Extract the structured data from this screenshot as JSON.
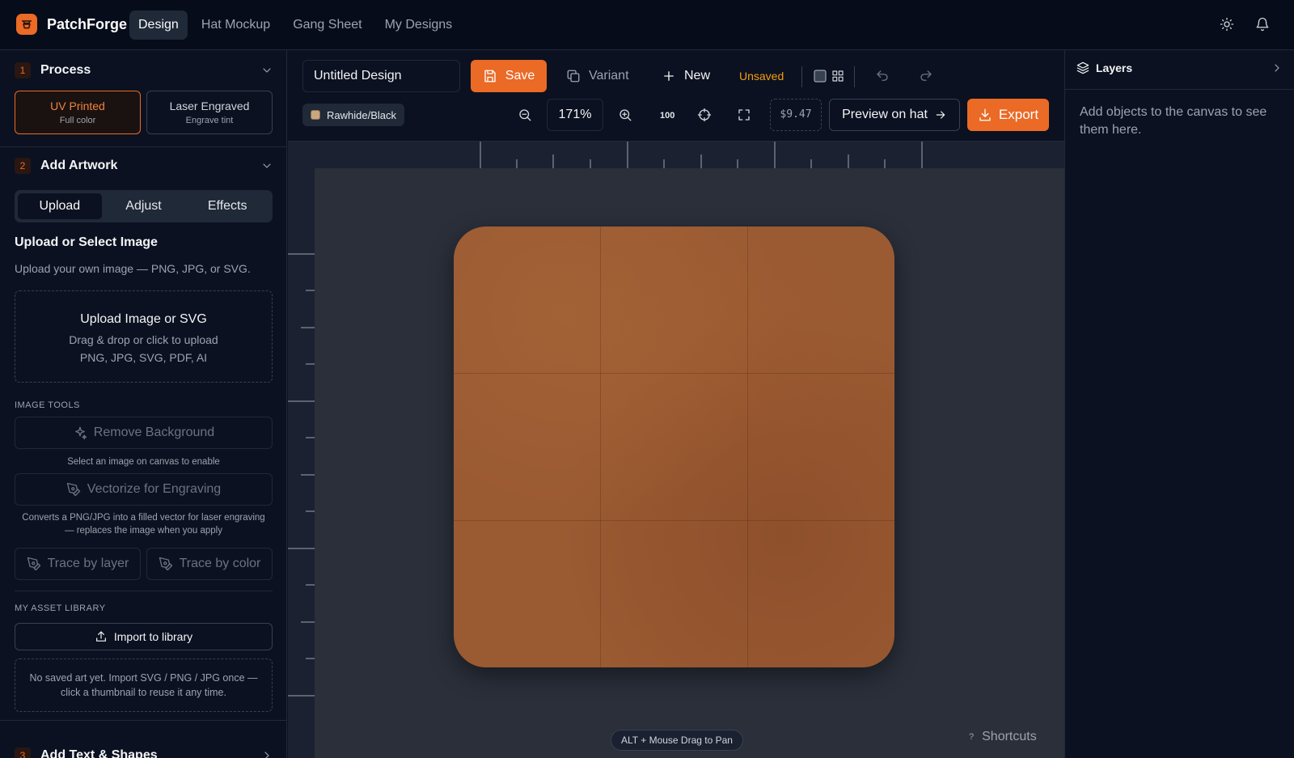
{
  "app": {
    "brand": "PatchForge"
  },
  "nav": [
    {
      "label": "Design",
      "active": true
    },
    {
      "label": "Hat Mockup",
      "active": false
    },
    {
      "label": "Gang Sheet",
      "active": false
    },
    {
      "label": "My Designs",
      "active": false
    }
  ],
  "left_panel": {
    "process": {
      "number": "1",
      "title": "Process",
      "options": [
        {
          "title": "UV Printed",
          "subtitle": "Full color",
          "selected": true
        },
        {
          "title": "Laser Engraved",
          "subtitle": "Engrave tint",
          "selected": false
        }
      ]
    },
    "artwork": {
      "number": "2",
      "title": "Add Artwork",
      "tabs": [
        "Upload",
        "Adjust",
        "Effects"
      ],
      "active_tab": "Upload",
      "upload_heading": "Upload or Select Image",
      "upload_desc": "Upload your own image — PNG, JPG, or SVG.",
      "dropzone": {
        "title": "Upload Image or SVG",
        "line1": "Drag & drop or click to upload",
        "line2": "PNG, JPG, SVG, PDF, AI"
      },
      "image_tools_label": "IMAGE TOOLS",
      "remove_bg": "Remove Background",
      "remove_bg_note": "Select an image on canvas to enable",
      "vectorize": "Vectorize for Engraving",
      "vectorize_note_1": "Converts a PNG/JPG into a filled vector for laser engraving",
      "vectorize_note_2": "— replaces the image when you apply",
      "trace_layer": "Trace by layer",
      "trace_color": "Trace by color",
      "asset_label": "MY ASSET LIBRARY",
      "import": "Import to library",
      "empty_1": "No saved art yet. Import SVG / PNG / JPG once —",
      "empty_2": "click a thumbnail to reuse it any time."
    },
    "text_shapes": {
      "number": "3",
      "title": "Add Text & Shapes"
    }
  },
  "toolbar": {
    "design_name": "Untitled Design",
    "save": "Save",
    "variant": "Variant",
    "new": "New",
    "status": "Unsaved",
    "material": "Rawhide/Black",
    "zoom": "171%",
    "zoom_100": "100",
    "price": "$9.47",
    "preview": "Preview on hat",
    "export": "Export"
  },
  "canvas": {
    "hint": "ALT + Mouse Drag to Pan",
    "shortcuts_key": "?",
    "shortcuts": "Shortcuts",
    "patch_color": "#9a5a32"
  },
  "right_panel": {
    "title": "Layers",
    "empty": "Add objects to the canvas to see them here."
  },
  "colors": {
    "accent": "#ea6a26",
    "status_unsaved": "#f59e0b",
    "background": "#0b1120"
  }
}
